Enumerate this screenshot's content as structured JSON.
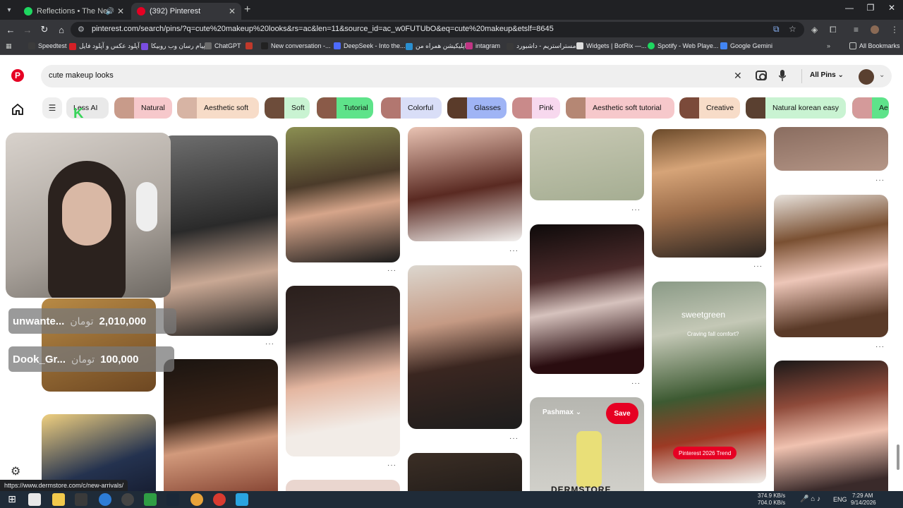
{
  "browser": {
    "tabs": [
      {
        "title": "Reflections • The Neighbou",
        "active": false,
        "favicon_color": "#1ed760"
      },
      {
        "title": "(392) Pinterest",
        "active": true,
        "favicon_color": "#e60023"
      }
    ],
    "url": "pinterest.com/search/pins/?q=cute%20makeup%20looks&rs=ac&len=11&source_id=ac_w0FUTUbO&eq=cute%20makeup&etslf=8645",
    "bookmarks": [
      {
        "label": "Speedtest",
        "color": "#3b3b3b"
      },
      {
        "label": "آپلود عکس و آپلود فایل",
        "color": "#d41f26"
      },
      {
        "label": "پیام رسان وب روبیکا",
        "color": "#7a4de0"
      },
      {
        "label": "ChatGPT",
        "color": "#6c6c6c"
      },
      {
        "label": "",
        "color": "#c0392b"
      },
      {
        "label": "New conversation -...",
        "color": "#222222"
      },
      {
        "label": "DeepSeek - Into the...",
        "color": "#4d6bfe"
      },
      {
        "label": "اپلیکیشن همراه من",
        "color": "#2a8fd0"
      },
      {
        "label": "intagram",
        "color": "#c13584"
      },
      {
        "label": "مستراستریم - داشبورد",
        "color": "#3a3a3a"
      },
      {
        "label": "Widgets | BotRix —...",
        "color": "#dddddd"
      },
      {
        "label": "Spotify - Web Playe...",
        "color": "#1ed760"
      },
      {
        "label": "Google Gemini",
        "color": "#4285f4"
      }
    ],
    "all_bookmarks_label": "All Bookmarks"
  },
  "pinterest": {
    "search_query": "cute makeup looks",
    "scope_label": "All Pins",
    "chips": [
      {
        "label": "Less AI",
        "bg": "#e9e9e9",
        "thumb": "#c89b8a"
      },
      {
        "label": "Natural",
        "bg": "#f6c8cb",
        "thumb": "#c89b8a"
      },
      {
        "label": "Aesthetic soft",
        "bg": "#f7dcc8",
        "thumb": "#d7b4a4"
      },
      {
        "label": "Soft",
        "bg": "#c9f3d2",
        "thumb": "#6d4c3a"
      },
      {
        "label": "Tutorial",
        "bg": "#5ee38a",
        "thumb": "#8a5a48"
      },
      {
        "label": "Colorful",
        "bg": "#d9def7",
        "thumb": "#b27770"
      },
      {
        "label": "Glasses",
        "bg": "#9fb4f5",
        "thumb": "#5a3b2a"
      },
      {
        "label": "Pink",
        "bg": "#f7d8ee",
        "thumb": "#c98a8a"
      },
      {
        "label": "Aesthetic soft tutorial",
        "bg": "#f6c8cb",
        "thumb": "#b58774"
      },
      {
        "label": "Creative",
        "bg": "#f7dcc8",
        "thumb": "#7b4a3a"
      },
      {
        "label": "Natural korean easy",
        "bg": "#c9f3d2",
        "thumb": "#5a4030"
      },
      {
        "label": "Ae",
        "bg": "#5ee38a",
        "thumb": "#d49a9a"
      }
    ],
    "pins": {
      "sponsor_name": "Pashmax",
      "save_label": "Save",
      "dermstore_text": "DERMSTORE",
      "sweetgreen_brand": "sweetgreen",
      "sweetgreen_caption": "Craving fall comfort?",
      "trend_badge": "Pinterest 2026 Trend"
    }
  },
  "overlays": {
    "donations": [
      {
        "name": "unwante...",
        "currency": "تومان",
        "amount": "2,010,000"
      },
      {
        "name": "Dook_Gr...",
        "currency": "تومان",
        "amount": "100,000"
      }
    ]
  },
  "status_url": "https://www.dermstore.com/c/new-arrivals/",
  "taskbar": {
    "net_up": "374.9 KB/s",
    "net_down": "704.0 KB/s",
    "lang": "ENG",
    "time": "7:29 AM",
    "date": "9/14/2026"
  }
}
